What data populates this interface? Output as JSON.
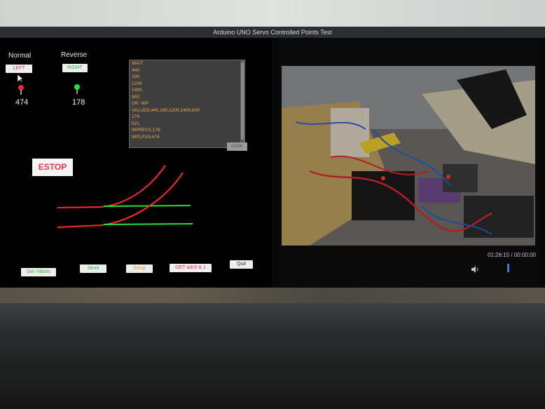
{
  "window": {
    "title": "Arduino UNO Servo Controlled Points Test"
  },
  "switch": {
    "normal_label": "Normal",
    "reverse_label": "Reverse",
    "left_button": "LEFT",
    "right_button": "RIGHT",
    "left_value": "474",
    "right_value": "178"
  },
  "log": {
    "lines": [
      "WAIT",
      "440",
      "190",
      "1200",
      "1400",
      "800",
      "OK: WP",
      "VALUES,440,190,1200,1400,800",
      "178",
      "521",
      "WPRP1S,178",
      "WPLP1S,474"
    ],
    "clear_button": "Clear"
  },
  "estop": {
    "label": "ESTOP"
  },
  "toolbar": {
    "get_values": "Get Values",
    "send": "Send",
    "setup": "Setup",
    "get_adc": "GET adc0 & 1",
    "quit": "Quit"
  },
  "video": {
    "timestamp": "01:26:15 / 00:00:00"
  },
  "colors": {
    "red_track": "#ff2a2a",
    "green_track": "#22e03a",
    "estop_text": "#e8364a",
    "log_text": "#f0a84a"
  }
}
